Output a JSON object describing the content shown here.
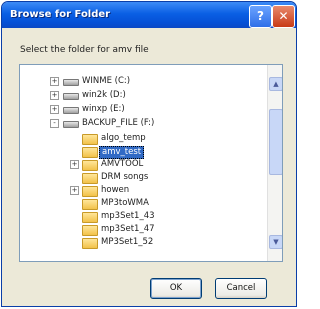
{
  "dialog": {
    "title": "Browse for Folder",
    "help_label": "?",
    "close_label": "✕",
    "prompt": "Select the folder for amv file",
    "ok_label": "OK",
    "cancel_label": "Cancel"
  },
  "tree": {
    "items": [
      {
        "label": "WINME (C:)",
        "type": "drive",
        "expander": "+"
      },
      {
        "label": "win2k (D:)",
        "type": "drive",
        "expander": "+"
      },
      {
        "label": "winxp (E:)",
        "type": "drive",
        "expander": "+"
      },
      {
        "label": "BACKUP_FILE (F:)",
        "type": "drive",
        "expander": "-"
      },
      {
        "label": "algo_temp",
        "type": "folder",
        "expander": ""
      },
      {
        "label": "amv_test",
        "type": "folder",
        "expander": "",
        "selected": true
      },
      {
        "label": "AMVTOOL",
        "type": "folder",
        "expander": "+"
      },
      {
        "label": "DRM songs",
        "type": "folder",
        "expander": ""
      },
      {
        "label": "howen",
        "type": "folder",
        "expander": "+"
      },
      {
        "label": "MP3toWMA",
        "type": "folder",
        "expander": ""
      },
      {
        "label": "mp3Set1_43",
        "type": "folder",
        "expander": ""
      },
      {
        "label": "mp3Set1_47",
        "type": "folder",
        "expander": ""
      },
      {
        "label": "MP3Set1_52",
        "type": "folder",
        "expander": ""
      }
    ]
  },
  "scrollbar": {
    "up_icon": "▲",
    "down_icon": "▼"
  },
  "colors": {
    "title_bar": "#0a5fe4",
    "selection": "#316ac5",
    "dialog_bg": "#ece9d8"
  }
}
